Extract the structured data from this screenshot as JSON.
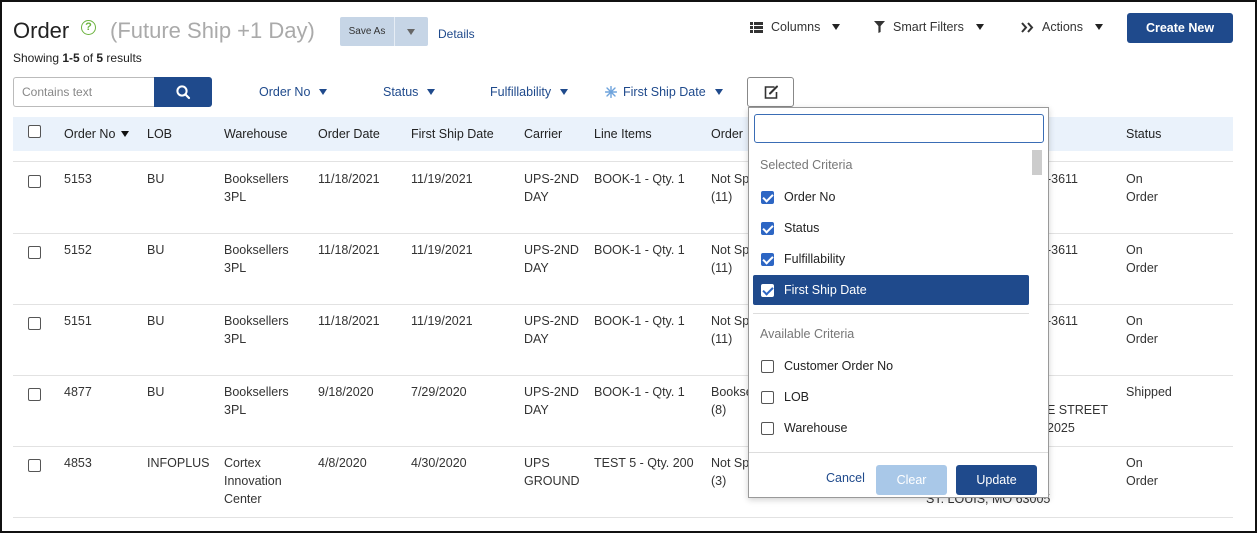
{
  "header": {
    "title": "Order",
    "help_icon": "?",
    "view_name": "(Future Ship +1 Day)",
    "save_as_label": "Save As",
    "details_label": "Details",
    "showing_prefix": "Showing ",
    "showing_range": "1-5",
    "showing_of": " of ",
    "showing_total": "5",
    "showing_suffix": " results"
  },
  "toolbar": {
    "columns_label": "Columns",
    "smart_filters_label": "Smart Filters",
    "actions_label": "Actions",
    "create_new_label": "Create New"
  },
  "search": {
    "placeholder": "Contains text",
    "value": ""
  },
  "filters": [
    {
      "label": "Order No"
    },
    {
      "label": "Status"
    },
    {
      "label": "Fulfillability"
    },
    {
      "label": "First Ship Date"
    }
  ],
  "table": {
    "columns": [
      "Order No",
      "LOB",
      "Warehouse",
      "Order Date",
      "First Ship Date",
      "Carrier",
      "Line Items",
      "Order",
      "Status"
    ],
    "rows": [
      {
        "order_no": "5153",
        "lob": "BU",
        "warehouse": [
          "Booksellers",
          "3PL"
        ],
        "order_date": "11/18/2021",
        "first_ship_date": "11/19/2021",
        "carrier": [
          "UPS-2ND",
          "DAY"
        ],
        "line_items": "BOOK-1 - Qty. 1",
        "order": [
          "Not Sp",
          "(11)"
        ],
        "address": [
          "",
          "6-3611"
        ],
        "status": [
          "On",
          "Order"
        ]
      },
      {
        "order_no": "5152",
        "lob": "BU",
        "warehouse": [
          "Booksellers",
          "3PL"
        ],
        "order_date": "11/18/2021",
        "first_ship_date": "11/19/2021",
        "carrier": [
          "UPS-2ND",
          "DAY"
        ],
        "line_items": "BOOK-1 - Qty. 1",
        "order": [
          "Not Sp",
          "(11)"
        ],
        "address": [
          "",
          "6-3611"
        ],
        "status": [
          "On",
          "Order"
        ]
      },
      {
        "order_no": "5151",
        "lob": "BU",
        "warehouse": [
          "Booksellers",
          "3PL"
        ],
        "order_date": "11/18/2021",
        "first_ship_date": "11/19/2021",
        "carrier": [
          "UPS-2ND",
          "DAY"
        ],
        "line_items": "BOOK-1 - Qty. 1",
        "order": [
          "Not Sp",
          "(11)"
        ],
        "address": [
          "",
          "6-3611"
        ],
        "status": [
          "On",
          "Order"
        ]
      },
      {
        "order_no": "4877",
        "lob": "BU",
        "warehouse": [
          "Booksellers",
          "3PL"
        ],
        "order_date": "9/18/2020",
        "first_ship_date": "7/29/2020",
        "carrier": [
          "UPS-2ND",
          "DAY"
        ],
        "line_items": "BOOK-1 - Qty. 1",
        "order": [
          "Bookse",
          "(8)"
        ],
        "address": [
          "LE STREET",
          "2025"
        ],
        "status": [
          "Shipped",
          ""
        ]
      },
      {
        "order_no": "4853",
        "lob": "INFOPLUS",
        "warehouse": [
          "Cortex",
          "Innovation",
          "Center"
        ],
        "order_date": "4/8/2020",
        "first_ship_date": "4/30/2020",
        "carrier": [
          "UPS",
          "GROUND"
        ],
        "line_items": "TEST 5 - Qty. 200",
        "order": [
          "Not Sp",
          "(3)"
        ],
        "address": [
          "",
          "",
          "ST. LOUIS, MO 63005"
        ],
        "status": [
          "On",
          "Order"
        ]
      }
    ]
  },
  "dropdown": {
    "search_value": "",
    "selected_header": "Selected Criteria",
    "selected": [
      {
        "label": "Order No",
        "checked": true
      },
      {
        "label": "Status",
        "checked": true
      },
      {
        "label": "Fulfillability",
        "checked": true
      },
      {
        "label": "First Ship Date",
        "checked": true
      }
    ],
    "available_header": "Available Criteria",
    "available": [
      {
        "label": "Customer Order No",
        "checked": false
      },
      {
        "label": "LOB",
        "checked": false
      },
      {
        "label": "Warehouse",
        "checked": false
      }
    ],
    "cancel_label": "Cancel",
    "clear_label": "Clear",
    "update_label": "Update"
  },
  "colors": {
    "primary": "#1f4a8c",
    "help_green": "#6cb33f",
    "header_row_bg": "#eaf2fb",
    "checkbox_blue": "#2d66c4"
  },
  "icons": {
    "columns": "list-icon",
    "smart_filters": "funnel-icon",
    "actions": "double-chevron-right-icon",
    "search": "magnifier-icon",
    "first_ship_date_filter": "snowflake-icon",
    "edit_criteria": "edit-square-icon"
  }
}
